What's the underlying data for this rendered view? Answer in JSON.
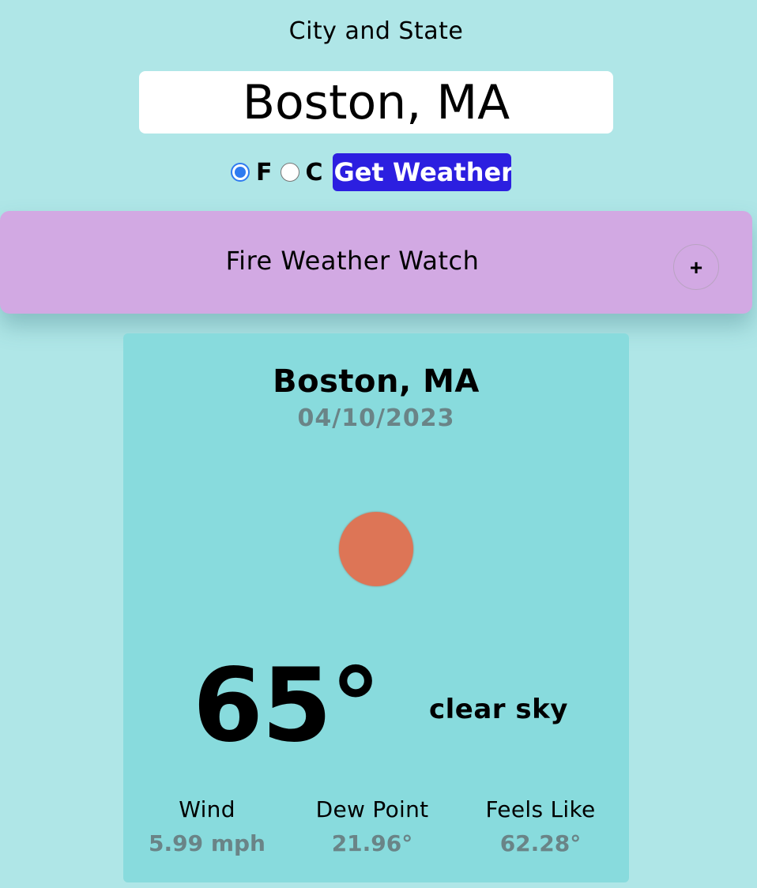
{
  "search": {
    "label": "City and State",
    "value": "Boston, MA"
  },
  "units": {
    "fahrenheit_label": "F",
    "celsius_label": "C",
    "selected": "F"
  },
  "submit": {
    "label": "Get Weather",
    "color": "#2c1fe0"
  },
  "alert": {
    "title": "Fire Weather Watch",
    "expand_label": "+",
    "color": "#d2a9e3"
  },
  "weather": {
    "city": "Boston, MA",
    "date": "04/10/2023",
    "icon": "sun-icon",
    "temperature": "65°",
    "condition": "clear sky",
    "stats": [
      {
        "label": "Wind",
        "value": "5.99 mph"
      },
      {
        "label": "Dew Point",
        "value": "21.96°"
      },
      {
        "label": "Feels Like",
        "value": "62.28°"
      }
    ]
  },
  "colors": {
    "background": "#afe6e7",
    "card": "#88dbdd",
    "sun": "#dd7556",
    "muted_text": "#6a8487"
  }
}
